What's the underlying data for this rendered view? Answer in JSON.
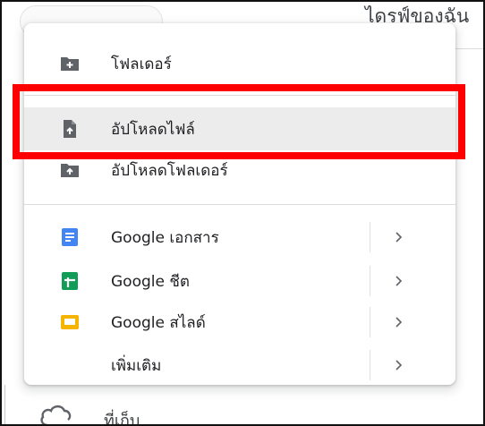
{
  "background": {
    "title": "ไดรฟ์ของฉัน",
    "bottom_item_label": "ที่เก็บ"
  },
  "menu": {
    "items": [
      {
        "label": "โฟลเดอร์",
        "icon": "new-folder-icon"
      },
      {
        "label": "อัปโหลดไฟล์",
        "icon": "file-upload-icon"
      },
      {
        "label": "อัปโหลดโฟลเดอร์",
        "icon": "folder-upload-icon"
      },
      {
        "label": "Google เอกสาร",
        "icon": "google-docs-icon",
        "submenu": true
      },
      {
        "label": "Google ชีต",
        "icon": "google-sheets-icon",
        "submenu": true
      },
      {
        "label": "Google สไลด์",
        "icon": "google-slides-icon",
        "submenu": true
      },
      {
        "label": "เพิ่มเติม",
        "submenu": true
      }
    ]
  },
  "colors": {
    "highlight": "#ff0000",
    "docs": "#4285f4",
    "sheets": "#0f9d58",
    "slides": "#f4b400",
    "icon_gray": "#5f6368"
  }
}
